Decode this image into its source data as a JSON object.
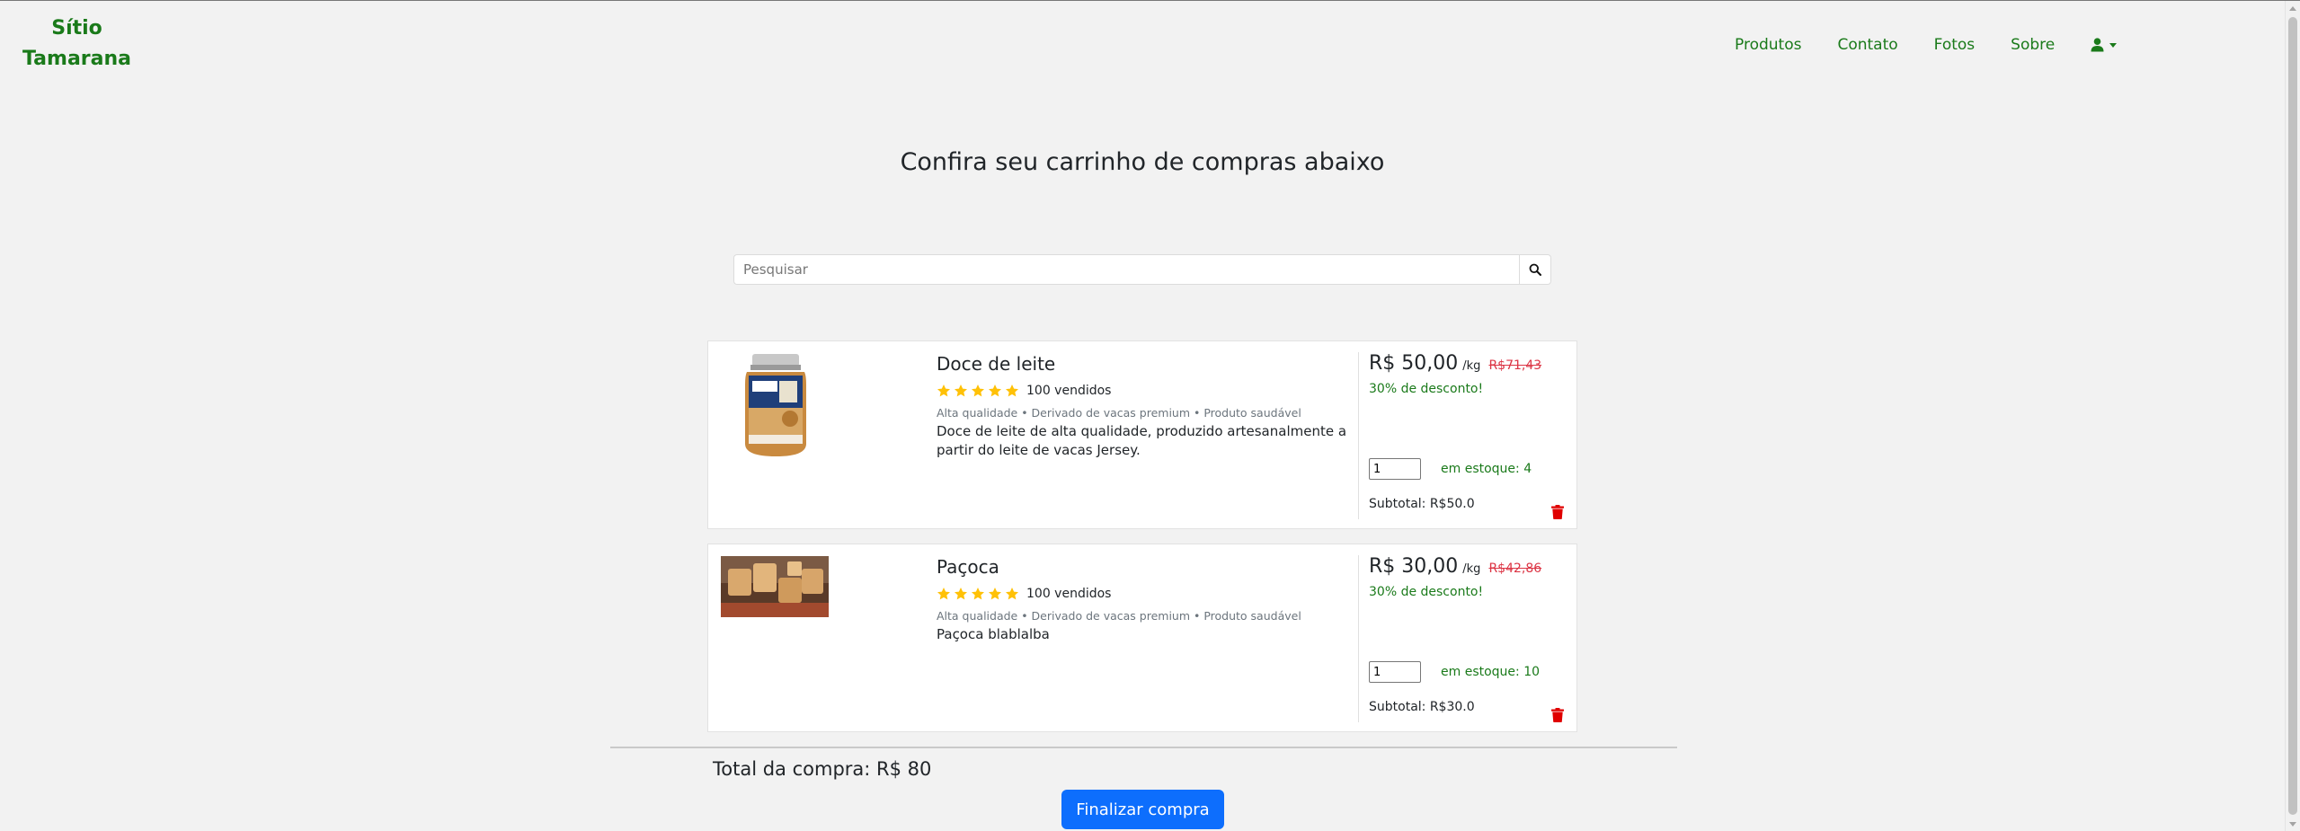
{
  "brand": {
    "line1": "Sítio",
    "line2": "Tamarana"
  },
  "nav": {
    "items": [
      "Produtos",
      "Contato",
      "Fotos",
      "Sobre"
    ],
    "user_icon": "user-icon"
  },
  "heading": "Confira seu carrinho de compras abaixo",
  "search": {
    "placeholder": "Pesquisar",
    "value": "",
    "icon": "search-icon"
  },
  "cart": {
    "items": [
      {
        "name": "Doce de leite",
        "rating": 5,
        "sold": "100 vendidos",
        "tags": "Alta qualidade • Derivado de vacas premium • Produto saudável",
        "description": "Doce de leite de alta qualidade, produzido artesanalmente a partir do leite de vacas Jersey.",
        "price": "R$ 50,00",
        "unit": "/kg",
        "old_price": "R$71,43",
        "discount": "30% de desconto!",
        "quantity": "1",
        "stock": "em estoque: 4",
        "subtotal": "Subtotal: R$50.0"
      },
      {
        "name": "Paçoca",
        "rating": 5,
        "sold": "100 vendidos",
        "tags": "Alta qualidade • Derivado de vacas premium • Produto saudável",
        "description": "Paçoca blablalba",
        "price": "R$ 30,00",
        "unit": "/kg",
        "old_price": "R$42,86",
        "discount": "30% de desconto!",
        "quantity": "1",
        "stock": "em estoque: 10",
        "subtotal": "Subtotal: R$30.0"
      }
    ]
  },
  "total": "Total da compra: R$ 80",
  "checkout_label": "Finalizar compra",
  "colors": {
    "brand_green": "#1a7a1a",
    "star": "#ffc107",
    "old_price": "#dc3545",
    "primary": "#0d6efd",
    "trash": "#e00000"
  }
}
